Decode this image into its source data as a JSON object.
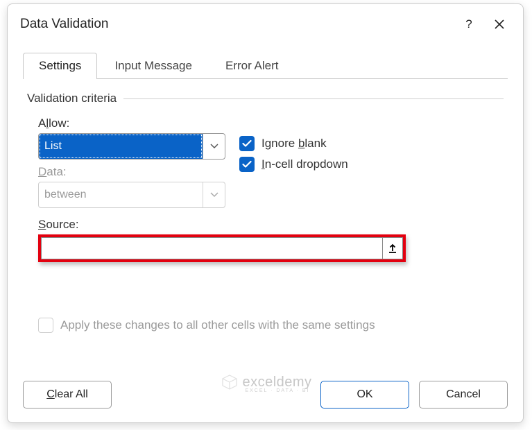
{
  "title": "Data Validation",
  "tabs": {
    "settings": "Settings",
    "input_message": "Input Message",
    "error_alert": "Error Alert"
  },
  "group": "Validation criteria",
  "labels": {
    "allow_pre": "A",
    "allow_u": "l",
    "allow_post": "low:",
    "data_pre": "",
    "data_u": "D",
    "data_post": "ata:",
    "source_pre": "",
    "source_u": "S",
    "source_post": "ource:"
  },
  "combos": {
    "allow_value": "List",
    "data_value": "between"
  },
  "checkboxes": {
    "ignore_pre": "Ignore ",
    "ignore_u": "b",
    "ignore_post": "lank",
    "incell_pre": "",
    "incell_u": "I",
    "incell_post": "n-cell dropdown"
  },
  "apply": {
    "pre": "Apply these changes to all other cells with the same settings",
    "u": "",
    "post": ""
  },
  "buttons": {
    "clear_pre": "",
    "clear_u": "C",
    "clear_post": "lear All",
    "ok": "OK",
    "cancel": "Cancel"
  },
  "watermark": {
    "text": "exceldemy",
    "sub": "EXCEL · DATA · BI"
  }
}
